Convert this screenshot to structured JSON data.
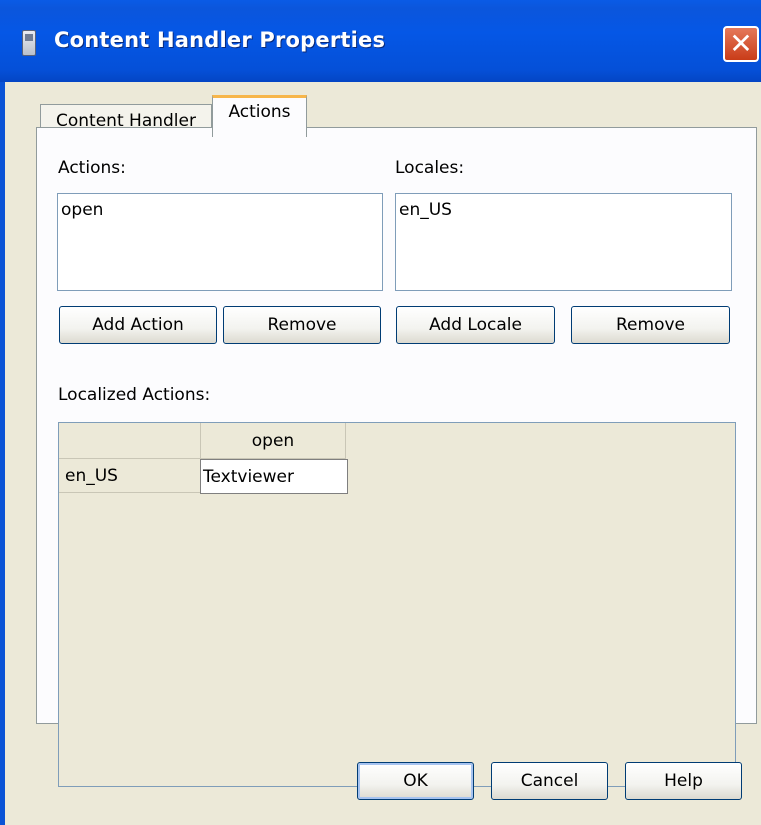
{
  "window": {
    "title": "Content Handler Properties",
    "close_symbol": "✕",
    "accent": "#0a53d6"
  },
  "tabs": [
    {
      "label": "Content Handler",
      "selected": false
    },
    {
      "label": "Actions",
      "selected": true
    }
  ],
  "actions": {
    "label": "Actions:",
    "items": [
      "open"
    ],
    "add_label": "Add Action",
    "remove_label": "Remove"
  },
  "locales": {
    "label": "Locales:",
    "items": [
      "en_US"
    ],
    "add_label": "Add Locale",
    "remove_label": "Remove"
  },
  "localized": {
    "label": "Localized Actions:",
    "columns": [
      "",
      "open"
    ],
    "rows": [
      {
        "locale": "en_US",
        "value": "Textviewer"
      }
    ]
  },
  "footer": {
    "ok_label": "OK",
    "cancel_label": "Cancel",
    "help_label": "Help"
  }
}
